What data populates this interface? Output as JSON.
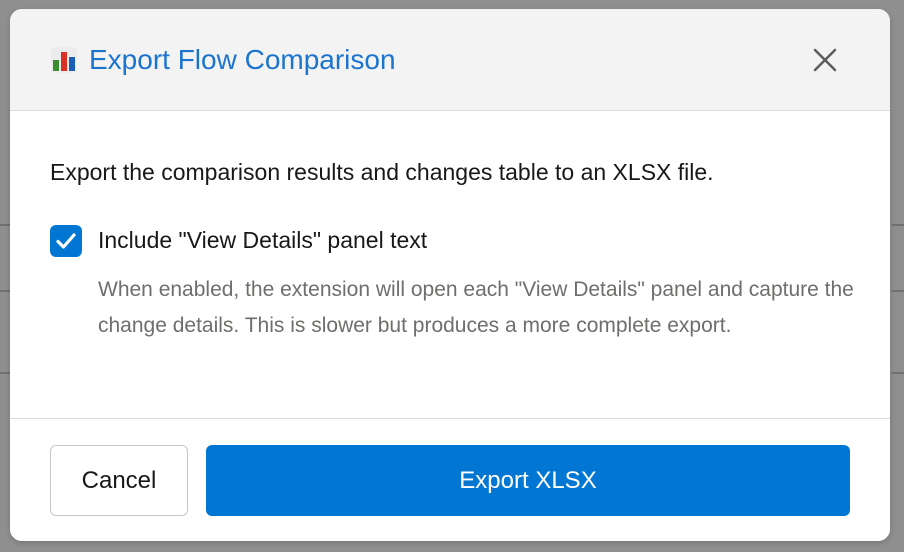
{
  "modal": {
    "title": "Export Flow Comparison",
    "title_icon": "bar-chart-icon",
    "close_icon": "close-icon"
  },
  "body": {
    "intro": "Export the comparison results and changes table to an XLSX file.",
    "include_details": {
      "checked": true,
      "label": "Include \"View Details\" panel text",
      "help": "When enabled, the extension will open each \"View Details\" panel and capture the change details. This is slower but produces a more complete export."
    }
  },
  "footer": {
    "cancel_label": "Cancel",
    "export_label": "Export XLSX"
  },
  "colors": {
    "brand": "#0176d3",
    "title": "#1b74cf",
    "help_text": "#706e6b",
    "overlay": "#8f8f8f"
  }
}
